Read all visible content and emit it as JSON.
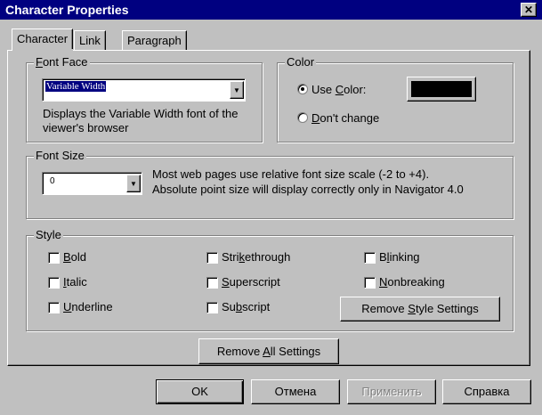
{
  "window": {
    "title": "Character Properties",
    "close_glyph": "✕"
  },
  "tabs": [
    "Character",
    "Link",
    "Paragraph"
  ],
  "font_face": {
    "legend_before": "",
    "legend_mnemonic": "F",
    "legend_after": "ont Face",
    "selected": "Variable Width",
    "description_line1": "Displays the Variable Width font of the",
    "description_line2": "viewer's browser"
  },
  "color": {
    "legend": "Color",
    "use_color_before": "Use ",
    "use_color_mnemonic": "C",
    "use_color_after": "olor:",
    "swatch": "#000000",
    "dont_change_mnemonic": "D",
    "dont_change_after": "on't change"
  },
  "font_size": {
    "legend": "Font Size",
    "value": "0",
    "info_line1": "Most web pages use relative font size scale (-2 to +4).",
    "info_line2": "Absolute point size will display correctly only in Navigator 4.0"
  },
  "style": {
    "legend": "Style",
    "bold": {
      "mnemonic": "B",
      "rest": "old"
    },
    "italic": {
      "mnemonic": "I",
      "rest": "talic"
    },
    "underline": {
      "mnemonic": "U",
      "rest": "nderline"
    },
    "strikethrough": {
      "before": "Stri",
      "mnemonic": "k",
      "rest": "ethrough"
    },
    "superscript": {
      "mnemonic": "S",
      "rest": "uperscript"
    },
    "subscript": {
      "before": "Su",
      "mnemonic": "b",
      "rest": "script"
    },
    "blinking": {
      "before": "B",
      "mnemonic": "l",
      "rest": "inking"
    },
    "nonbreaking": {
      "mnemonic": "N",
      "rest": "onbreaking"
    },
    "remove_style_before": "Remove ",
    "remove_style_mnemonic": "S",
    "remove_style_after": "tyle Settings"
  },
  "remove_all": {
    "before": "Remove ",
    "mnemonic": "A",
    "after": "ll Settings"
  },
  "buttons": {
    "ok": "OK",
    "cancel": "Отмена",
    "apply": "Применить",
    "help": "Справка"
  },
  "icons": {
    "dropdown": "▼"
  }
}
